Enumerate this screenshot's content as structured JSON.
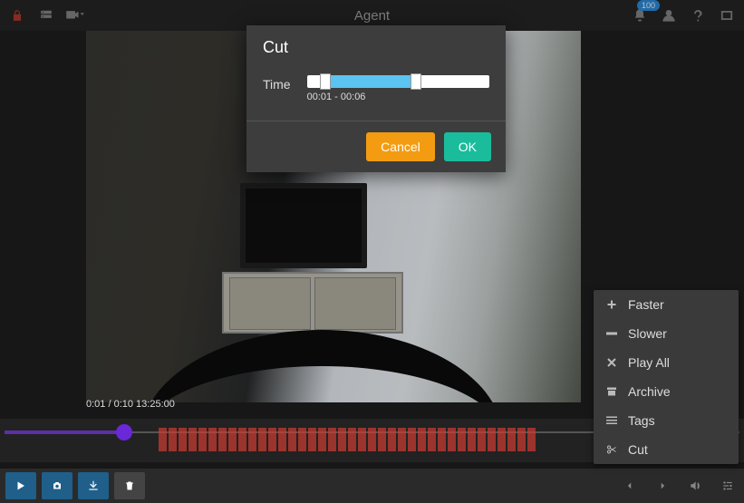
{
  "header": {
    "title": "Agent",
    "notif_count": "100"
  },
  "dialog": {
    "title": "Cut",
    "time_label": "Time",
    "range_text": "00:01 - 00:06",
    "cancel": "Cancel",
    "ok": "OK"
  },
  "video": {
    "time_overlay": "0:01 / 0:10  13:25:00"
  },
  "menu": {
    "items": [
      {
        "icon": "plus",
        "label": "Faster"
      },
      {
        "icon": "minus",
        "label": "Slower"
      },
      {
        "icon": "x",
        "label": "Play All"
      },
      {
        "icon": "archive",
        "label": "Archive"
      },
      {
        "icon": "list",
        "label": "Tags"
      },
      {
        "icon": "cut",
        "label": "Cut"
      }
    ]
  },
  "colors": {
    "accent_blue": "#2b8fe0",
    "cancel": "#f39c12",
    "ok": "#1abc9c",
    "playhead": "#6a28d9"
  }
}
